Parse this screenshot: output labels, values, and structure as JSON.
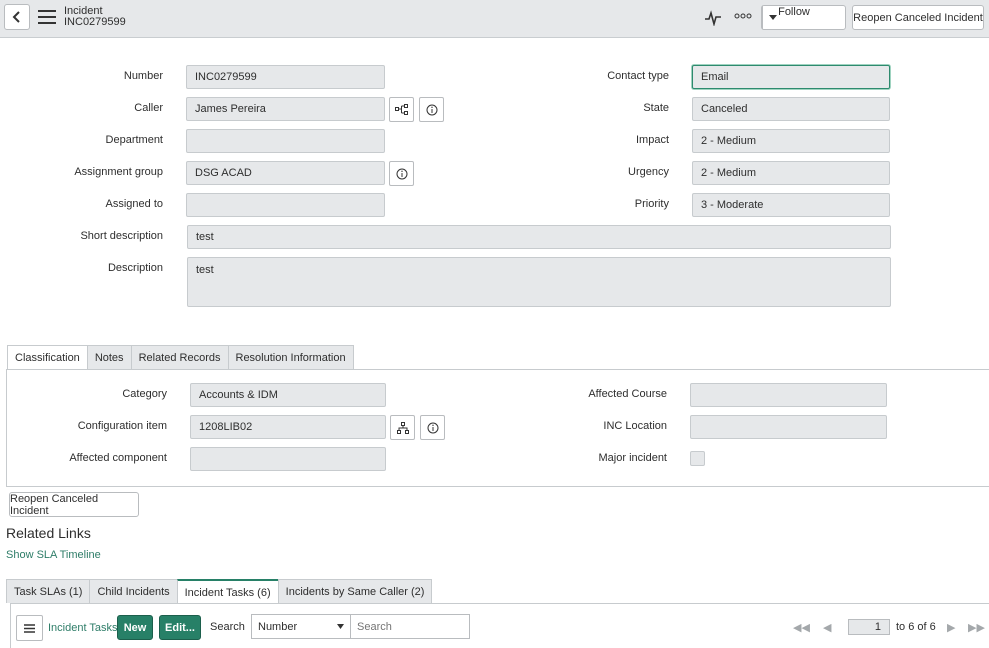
{
  "header": {
    "title": "Incident",
    "number": "INC0279599",
    "follow_label": "Follow",
    "reopen_label": "Reopen Canceled Incident"
  },
  "form": {
    "number_label": "Number",
    "number_value": "INC0279599",
    "caller_label": "Caller",
    "caller_value": "James Pereira",
    "department_label": "Department",
    "department_value": "",
    "assignment_group_label": "Assignment group",
    "assignment_group_value": "DSG ACAD",
    "assigned_to_label": "Assigned to",
    "assigned_to_value": "",
    "short_description_label": "Short description",
    "short_description_value": "test",
    "description_label": "Description",
    "description_value": "test",
    "contact_type_label": "Contact type",
    "contact_type_value": "Email",
    "state_label": "State",
    "state_value": "Canceled",
    "impact_label": "Impact",
    "impact_value": "2 - Medium",
    "urgency_label": "Urgency",
    "urgency_value": "2 - Medium",
    "priority_label": "Priority",
    "priority_value": "3 - Moderate"
  },
  "tabs": [
    "Classification",
    "Notes",
    "Related Records",
    "Resolution Information"
  ],
  "classification": {
    "category_label": "Category",
    "category_value": "Accounts & IDM",
    "ci_label": "Configuration item",
    "ci_value": "1208LIB02",
    "affected_component_label": "Affected component",
    "affected_component_value": "",
    "affected_course_label": "Affected Course",
    "affected_course_value": "",
    "inc_location_label": "INC Location",
    "inc_location_value": "",
    "major_incident_label": "Major incident"
  },
  "reopen_bottom_label": "Reopen Canceled Incident",
  "related_links": {
    "title": "Related Links",
    "show_sla_timeline": "Show SLA Timeline"
  },
  "related_tabs": [
    "Task SLAs (1)",
    "Child Incidents",
    "Incident Tasks (6)",
    "Incidents by Same Caller (2)"
  ],
  "list": {
    "title": "Incident Tasks",
    "new_label": "New",
    "edit_label": "Edit...",
    "search_label": "Search",
    "search_field": "Number",
    "search_placeholder": "Search",
    "page_value": "1",
    "range_text": "to 6 of 6"
  },
  "colors": {
    "accent": "#278067",
    "link": "#2e7d68",
    "field_bg": "#e6e8ea"
  }
}
